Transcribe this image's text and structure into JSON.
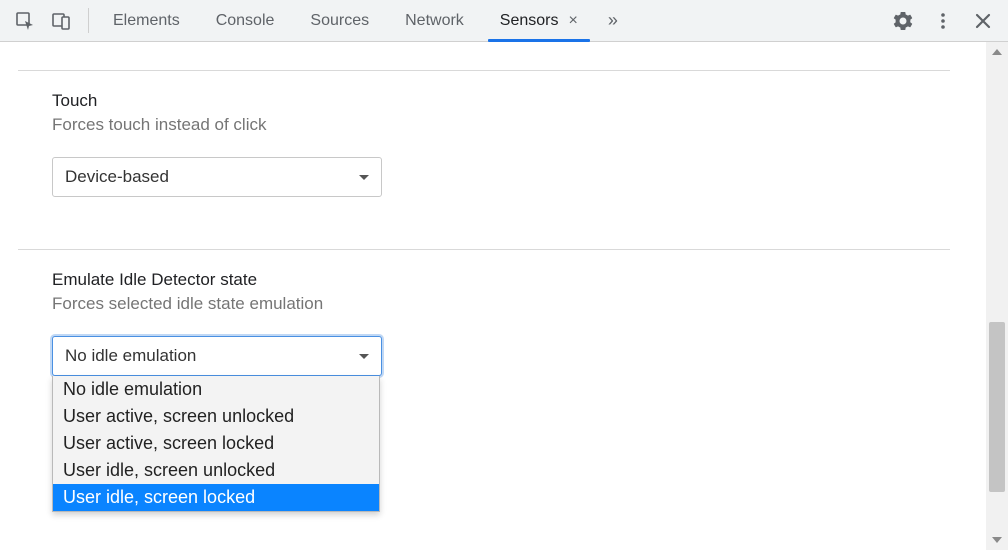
{
  "toolbar": {
    "tabs": [
      {
        "label": "Elements"
      },
      {
        "label": "Console"
      },
      {
        "label": "Sources"
      },
      {
        "label": "Network"
      },
      {
        "label": "Sensors",
        "active": true
      }
    ],
    "overflow_glyph": "»"
  },
  "sections": {
    "touch": {
      "title": "Touch",
      "desc": "Forces touch instead of click",
      "selected": "Device-based"
    },
    "idle": {
      "title": "Emulate Idle Detector state",
      "desc": "Forces selected idle state emulation",
      "selected": "No idle emulation",
      "options": [
        "No idle emulation",
        "User active, screen unlocked",
        "User active, screen locked",
        "User idle, screen unlocked",
        "User idle, screen locked"
      ],
      "highlighted_index": 4
    }
  }
}
